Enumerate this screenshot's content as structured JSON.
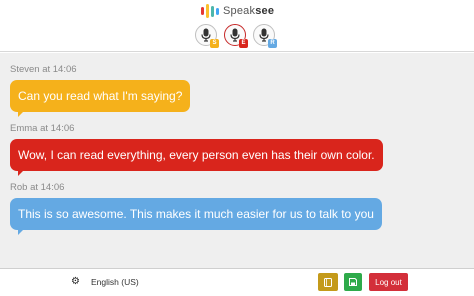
{
  "brand": {
    "name_light": "Speak",
    "name_bold": "see",
    "logo_colors": [
      "#e53935",
      "#fbc02d",
      "#4db6ac",
      "#42a5f5"
    ]
  },
  "participants": [
    {
      "initial": "S",
      "icon": "microphone-icon",
      "color": "#f5b11b",
      "active": false
    },
    {
      "initial": "E",
      "icon": "microphone-icon",
      "color": "#d9251c",
      "active": true
    },
    {
      "initial": "R",
      "icon": "microphone-icon",
      "color": "#64a9e3",
      "active": false
    }
  ],
  "messages": [
    {
      "meta": "Steven at 14:06",
      "text": "Can you read what I'm saying?",
      "color": "#f5b11b"
    },
    {
      "meta": "Emma at 14:06",
      "text": "Wow, I can read everything, every person even has their own color.",
      "color": "#d9251c"
    },
    {
      "meta": "Rob at 14:06",
      "text": "This is so awesome. This makes it much easier for us to talk to you",
      "color": "#64a9e3"
    }
  ],
  "footer": {
    "settings_icon": "gear-icon",
    "language": "English (US)",
    "notes_icon": "notebook-icon",
    "save_icon": "save-icon",
    "logout_label": "Log out",
    "notes_color": "#c49a1a",
    "save_color": "#2eaa4a",
    "logout_color": "#d32f3a"
  }
}
